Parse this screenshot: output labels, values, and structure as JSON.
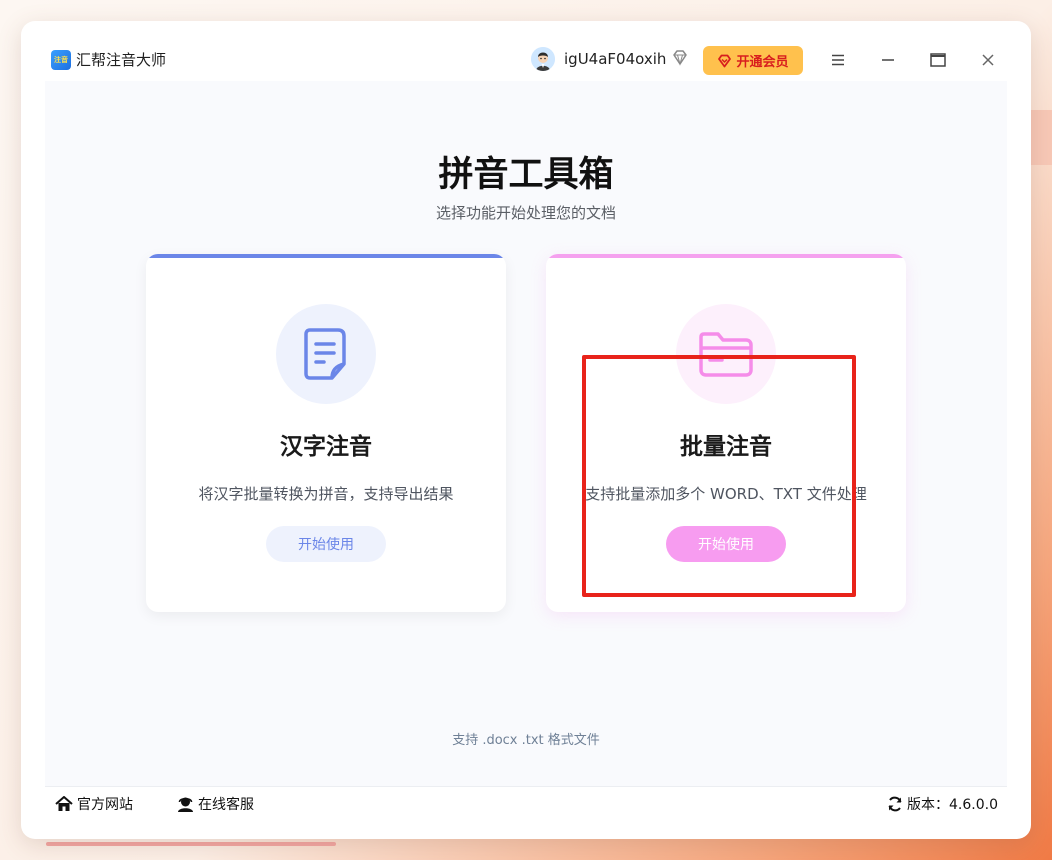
{
  "app": {
    "title": "汇帮注音大师",
    "logo_text": "注音"
  },
  "header": {
    "username": "igU4aF04oxih",
    "vip_label": "开通会员",
    "controls": [
      "menu-icon",
      "minimize-icon",
      "maximize-icon",
      "close-icon"
    ]
  },
  "main": {
    "title": "拼音工具箱",
    "subtitle": "选择功能开始处理您的文档",
    "cards": [
      {
        "title": "汉字注音",
        "desc": "将汉字批量转换为拼音，支持导出结果",
        "button": "开始使用",
        "icon": "document-icon",
        "accent": "#6b86e8"
      },
      {
        "title": "批量注音",
        "desc": "支持批量添加多个 WORD、TXT 文件处理",
        "button": "开始使用",
        "icon": "folder-icon",
        "accent": "#f5a1ef"
      }
    ],
    "support_note": "支持 .docx .txt 格式文件"
  },
  "footer": {
    "website_label": "官方网站",
    "service_label": "在线客服",
    "version_label": "版本：4.6.0.0"
  },
  "colors": {
    "vip_bg": "#ffc14d",
    "highlight": "#e8231a"
  }
}
